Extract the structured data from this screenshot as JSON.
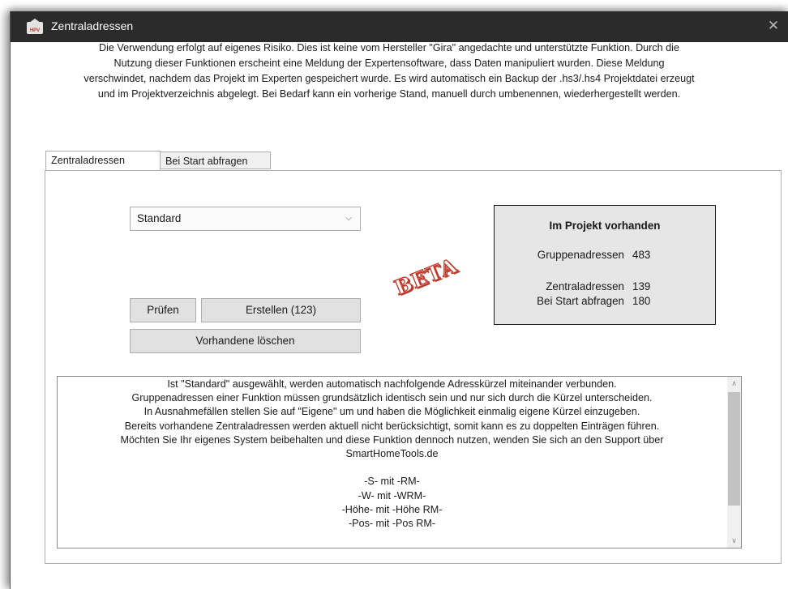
{
  "window": {
    "title": "Zentraladressen",
    "logo_text": "HPV",
    "close_icon": "close-icon"
  },
  "disclaimer": {
    "lines": [
      "Die Verwendung erfolgt auf eigenes Risiko. Dies ist keine vom Hersteller \"Gira\" angedachte und unterstützte Funktion. Durch die",
      "Nutzung dieser Funktionen erscheint eine Meldung der Expertensoftware, dass Daten manipuliert wurden. Diese Meldung",
      "verschwindet, nachdem das Projekt im Experten gespeichert wurde. Es wird automatisch ein Backup der .hs3/.hs4 Projektdatei erzeugt",
      "und im Projektverzeichnis abgelegt. Bei Bedarf kann ein vorherige Stand, manuell durch umbenennen, wiederhergestellt werden."
    ]
  },
  "tabs": [
    {
      "label": "Zentraladressen",
      "active": true
    },
    {
      "label": "Bei Start abfragen",
      "active": false
    }
  ],
  "mode_select": {
    "value": "Standard"
  },
  "buttons": {
    "check": "Prüfen",
    "create": "Erstellen (123)",
    "delete_existing": "Vorhandene löschen"
  },
  "beta_stamp": "BETA",
  "project_info": {
    "title": "Im Projekt vorhanden",
    "rows": [
      {
        "label": "Gruppenadressen",
        "value": "483"
      },
      {
        "label": "Zentraladressen",
        "value": "139"
      },
      {
        "label": "Bei Start abfragen",
        "value": "180"
      }
    ]
  },
  "help_text": {
    "lines": [
      "Ist \"Standard\" ausgewählt, werden automatisch nachfolgende Adresskürzel miteinander verbunden.",
      "Gruppenadressen einer Funktion müssen grundsätzlich identisch sein und nur sich durch die Kürzel unterscheiden.",
      "In Ausnahmefällen stellen Sie auf \"Eigene\" um und haben die Möglichkeit einmalig eigene Kürzel einzugeben.",
      "Bereits vorhandene Zentraladressen werden aktuell nicht berücksichtigt, somit kann es zu doppelten Einträgen führen.",
      "Möchten Sie Ihr eigenes System beibehalten und diese Funktion dennoch nutzen, wenden Sie sich an den Support über",
      "SmartHomeTools.de",
      "",
      "-S- mit -RM-",
      "-W- mit -WRM-",
      "-Höhe- mit -Höhe RM-",
      "-Pos- mit -Pos RM-"
    ]
  }
}
